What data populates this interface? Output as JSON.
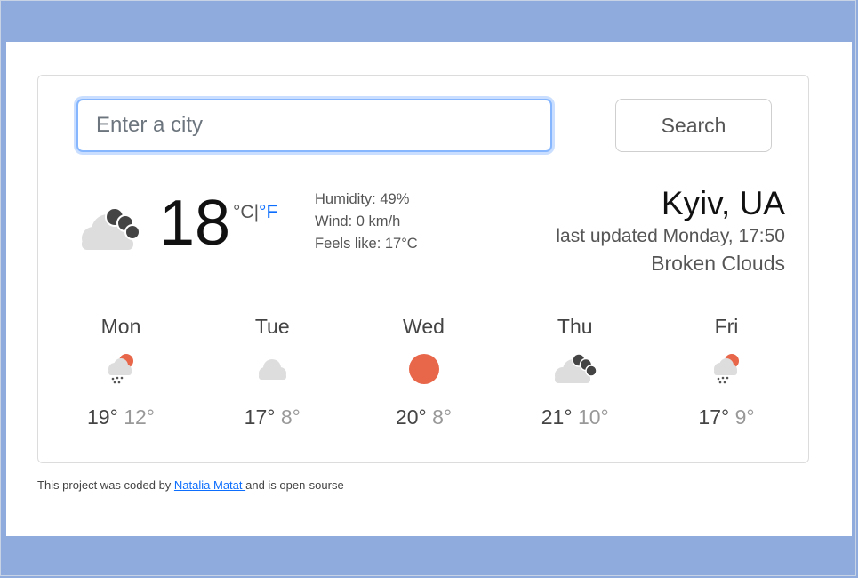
{
  "search": {
    "placeholder": "Enter a city",
    "button_label": "Search"
  },
  "current": {
    "temperature": "18",
    "unit_c": "°C",
    "unit_sep": "|",
    "unit_f": "°F",
    "humidity": "Humidity: 49%",
    "wind": "Wind: 0 km/h",
    "feels_like": "Feels like: 17°C",
    "icon": "broken-clouds-icon",
    "city": "Kyiv, UA",
    "last_updated": "last updated Monday, 17:50",
    "description": "Broken Clouds"
  },
  "forecast": [
    {
      "day": "Mon",
      "icon": "rain-icon",
      "max": "19°",
      "min": "12°"
    },
    {
      "day": "Tue",
      "icon": "cloud-icon",
      "max": "17°",
      "min": "8°"
    },
    {
      "day": "Wed",
      "icon": "sun-icon",
      "max": "20°",
      "min": "8°"
    },
    {
      "day": "Thu",
      "icon": "broken-clouds-icon",
      "max": "21°",
      "min": "10°"
    },
    {
      "day": "Fri",
      "icon": "rain-icon",
      "max": "17°",
      "min": "9°"
    }
  ],
  "footer": {
    "prefix": "This project was coded by ",
    "author": "Natalia Matat ",
    "suffix": "and is open-sourse"
  },
  "colors": {
    "background": "#8faadc",
    "accent": "#0d6efd",
    "sun": "#e8664a",
    "cloud_dark": "#444444",
    "cloud_light": "#dddddd"
  }
}
